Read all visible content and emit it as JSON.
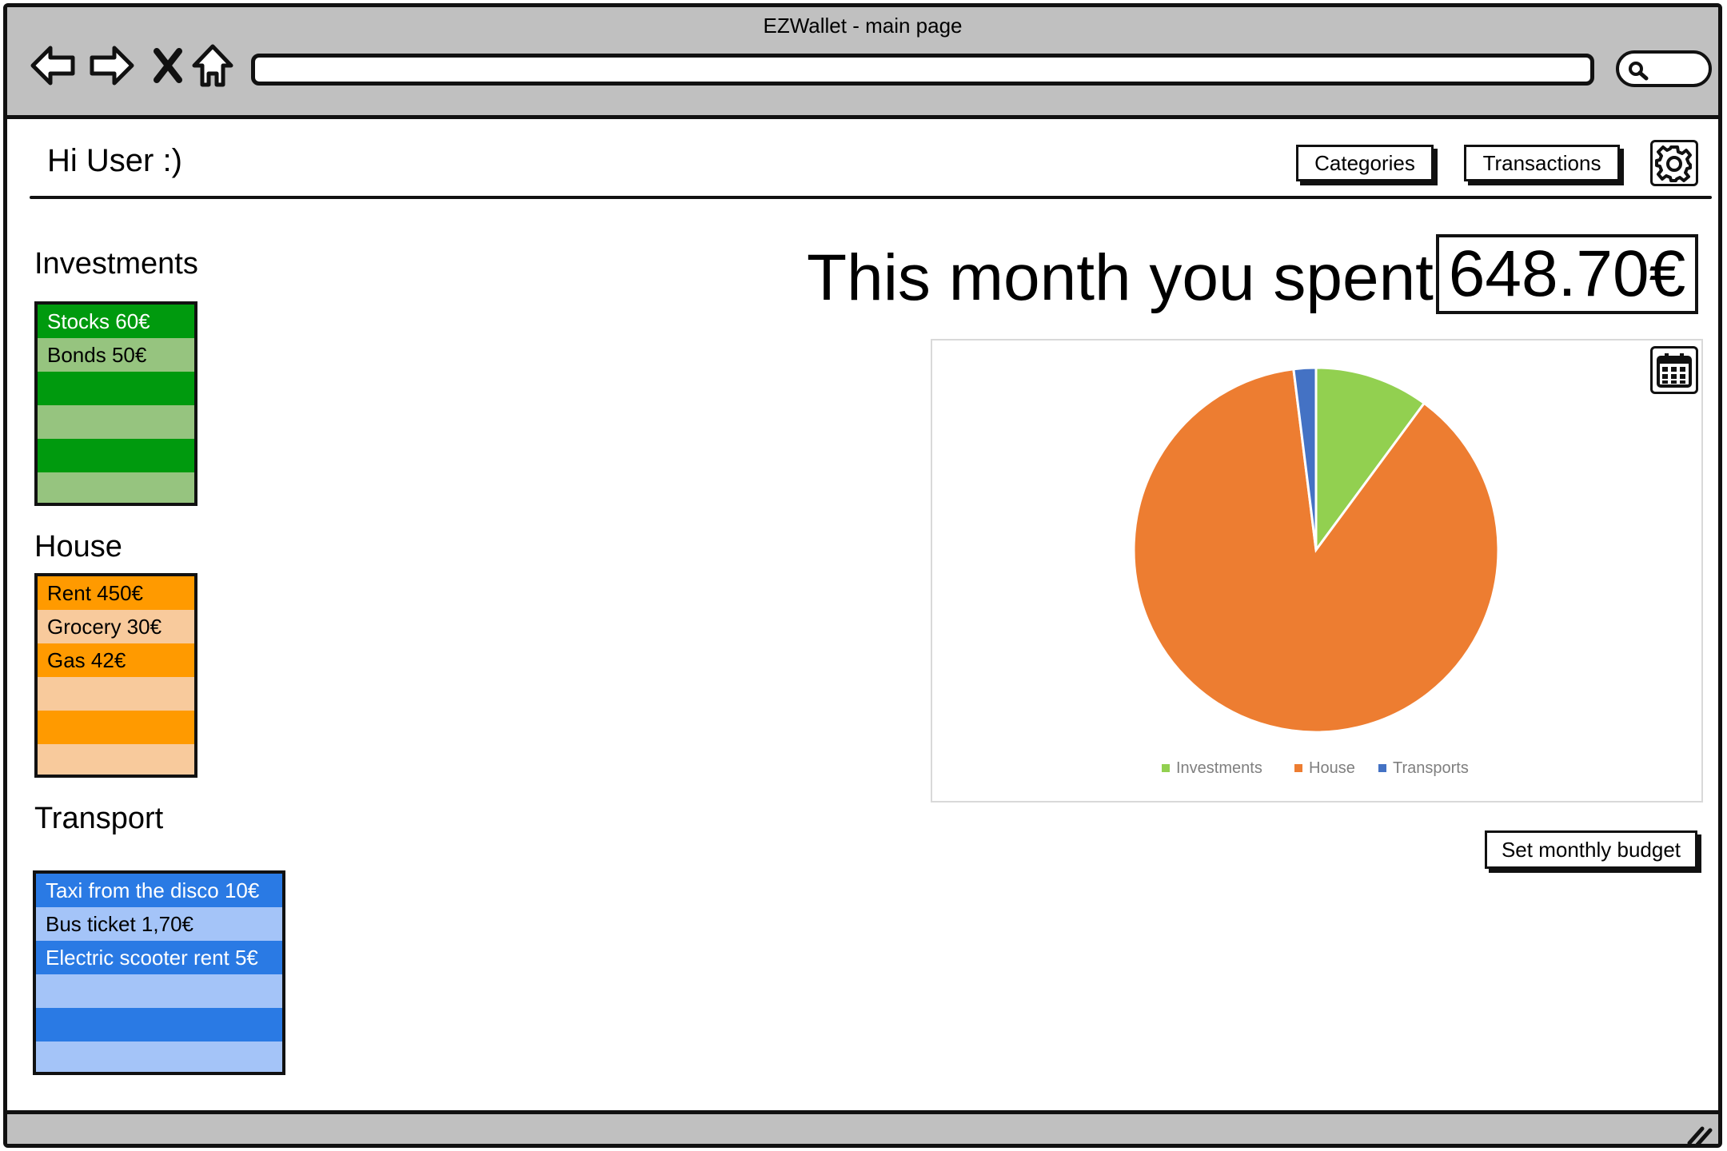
{
  "window": {
    "title": "EZWallet - main page"
  },
  "header": {
    "greeting": "Hi User :)",
    "categories_label": "Categories",
    "transactions_label": "Transactions"
  },
  "groups": {
    "investments": {
      "title": "Investments",
      "color_dark": "#009a0e",
      "color_light": "#96c47f",
      "items": [
        "Stocks 60€",
        "Bonds 50€",
        "",
        "",
        "",
        ""
      ]
    },
    "house": {
      "title": "House",
      "color_dark": "#ff9a00",
      "color_light": "#f8ca9c",
      "items": [
        "Rent 450€",
        "Grocery 30€",
        "Gas 42€",
        "",
        "",
        ""
      ]
    },
    "transport": {
      "title": "Transport",
      "color_dark": "#2a7ae4",
      "color_light": "#a4c4f8",
      "items": [
        "Taxi from the disco 10€",
        "Bus ticket 1,70€",
        "Electric scooter rent 5€",
        "",
        "",
        ""
      ]
    }
  },
  "summary": {
    "label": "This month you spent",
    "amount": "648.70€"
  },
  "chart_data": {
    "type": "pie",
    "labels": [
      "Investments",
      "House",
      "Transports"
    ],
    "values": [
      60,
      522,
      11.7
    ],
    "colors": [
      "#92d050",
      "#ed7d31",
      "#4472c4"
    ],
    "legend": "bottom"
  },
  "actions": {
    "set_budget_label": "Set monthly budget"
  },
  "icons": [
    "back-arrow-icon",
    "forward-arrow-icon",
    "close-icon",
    "home-icon",
    "search-icon",
    "gear-icon",
    "calendar-icon",
    "resize-grip-icon"
  ]
}
